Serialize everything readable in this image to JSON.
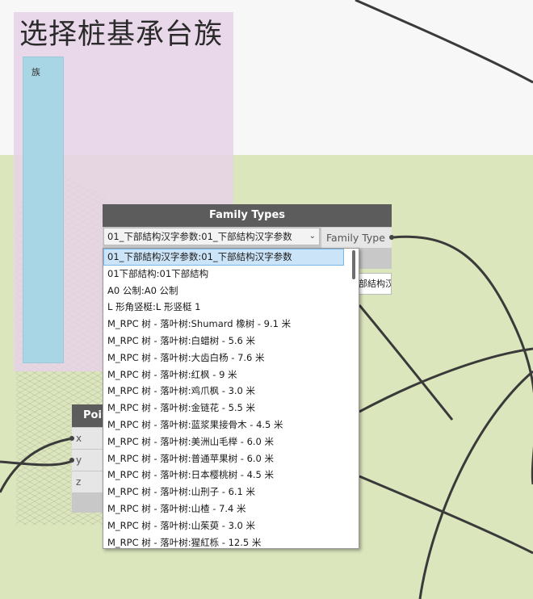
{
  "group": {
    "title": "选择桩基承台族",
    "note_label": "族"
  },
  "point_node": {
    "title": "Poin",
    "ports": [
      "x",
      "y",
      "z"
    ]
  },
  "family_types_node": {
    "title": "Family Types",
    "selected_value": "01_下部結构汉字参数:01_下部結构汉字参数",
    "output_label": "Family Type",
    "preview_text": "部結构汉"
  },
  "dropdown": {
    "selected_index": 0,
    "options": [
      "01_下部結构汉字参数:01_下部結构汉字参数",
      "01下部結构:01下部結构",
      "A0 公制:A0 公制",
      "L 形角竖梃:L 形竖梃 1",
      "M_RPC 树 - 落叶树:Shumard 橡树 - 9.1 米",
      "M_RPC 树 - 落叶树:白蜡树 - 5.6 米",
      "M_RPC 树 - 落叶树:大齿白杨 - 7.6 米",
      "M_RPC 树 - 落叶树:红枫 - 9 米",
      "M_RPC 树 - 落叶树:鸡爪枫 - 3.0 米",
      "M_RPC 树 - 落叶树:金链花 - 5.5 米",
      "M_RPC 树 - 落叶树:蓝浆果接骨木 - 4.5 米",
      "M_RPC 树 - 落叶树:美洲山毛榉 - 6.0 米",
      "M_RPC 树 - 落叶树:普通苹果树 - 6.0 米",
      "M_RPC 树 - 落叶树:日本樱桃树 - 4.5 米",
      "M_RPC 树 - 落叶树:山刑子 - 6.1 米",
      "M_RPC 树 - 落叶树:山楂 - 7.4 米",
      "M_RPC 树 - 落叶树:山茱萸 - 3.0 米",
      "M_RPC 树 - 落叶树:猩紅栎 - 12.5 米"
    ]
  },
  "colors": {
    "canvas_top": "#f7f7f7",
    "canvas_bottom": "#dce6bd",
    "group_bg": "#e6d2e8",
    "note_card": "#a9d6e5",
    "node_header": "#5c5c5c",
    "selection": "#cce4f7"
  }
}
